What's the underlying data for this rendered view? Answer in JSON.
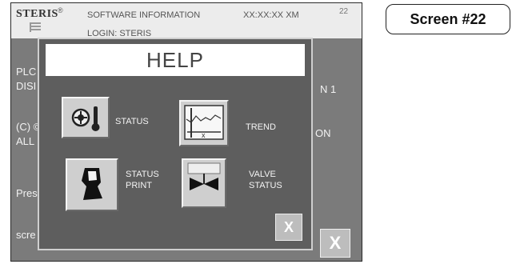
{
  "topbar": {
    "brand": "STERIS",
    "brand_mark": "®",
    "software_info": "SOFTWARE INFORMATION",
    "login": "LOGIN: STERIS",
    "clock": "XX:XX:XX XM",
    "screen_number": "22"
  },
  "background": {
    "line1": "PLC",
    "line1_right": "N 1",
    "line2": "DISI",
    "line3": "(C) ©",
    "line3_right": "ON",
    "line4": "ALL",
    "line5": "Pres",
    "line6": "scre",
    "close_label": "X"
  },
  "dialog": {
    "title": "HELP",
    "items": [
      {
        "icon": "status-gauge-icon",
        "label": "STATUS"
      },
      {
        "icon": "trend-graph-icon",
        "label": "TREND"
      },
      {
        "icon": "status-print-icon",
        "label": "STATUS\nPRINT"
      },
      {
        "icon": "valve-status-icon",
        "label": "VALVE\nSTATUS"
      }
    ],
    "close_label": "X"
  },
  "side_label": "Screen #22"
}
